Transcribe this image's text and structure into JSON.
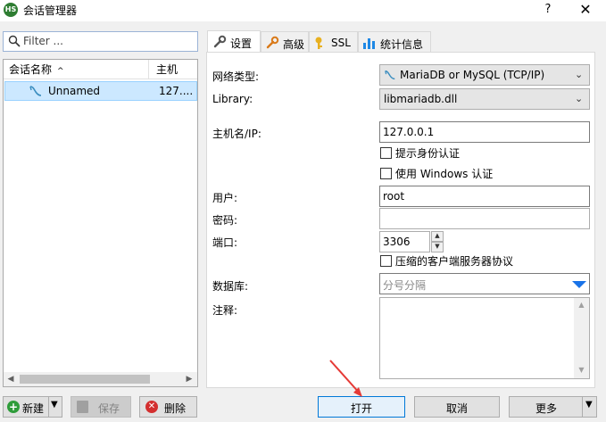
{
  "window": {
    "app_icon_text": "HS",
    "title": "会话管理器",
    "help_glyph": "?",
    "close_glyph": "✕"
  },
  "filter": {
    "placeholder": "Filter ..."
  },
  "session_list": {
    "columns": {
      "name": "会话名称",
      "host": "主机",
      "sort_indicator": "^"
    },
    "rows": [
      {
        "name": "Unnamed",
        "host": "127....",
        "selected": true
      }
    ]
  },
  "left_buttons": {
    "new": "新建",
    "save": "保存",
    "delete": "删除"
  },
  "tabs": [
    {
      "label": "设置",
      "icon": "wrench-icon",
      "active": true
    },
    {
      "label": "高级",
      "icon": "wrench-orange-icon",
      "active": false
    },
    {
      "label": "SSL",
      "icon": "lock-icon",
      "active": false
    },
    {
      "label": "统计信息",
      "icon": "bar-chart-icon",
      "active": false
    }
  ],
  "settings": {
    "network_type": {
      "label": "网络类型:",
      "value": "MariaDB or MySQL (TCP/IP)"
    },
    "library": {
      "label": "Library:",
      "value": "libmariadb.dll"
    },
    "hostname": {
      "label": "主机名/IP:",
      "value": "127.0.0.1"
    },
    "prompt_credentials": {
      "label": "提示身份认证",
      "checked": false
    },
    "windows_auth": {
      "label": "使用 Windows 认证",
      "checked": false
    },
    "user": {
      "label": "用户:",
      "value": "root"
    },
    "password": {
      "label": "密码:",
      "value": ""
    },
    "port": {
      "label": "端口:",
      "value": "3306"
    },
    "compressed": {
      "label": "压缩的客户端服务器协议",
      "checked": false
    },
    "databases": {
      "label": "数据库:",
      "placeholder": "分号分隔"
    },
    "comment": {
      "label": "注释:",
      "value": ""
    }
  },
  "right_buttons": {
    "open": "打开",
    "cancel": "取消",
    "more": "更多"
  },
  "colors": {
    "selection": "#cce8ff",
    "accent_blue": "#1a73e8",
    "annotation_red": "#e53935"
  }
}
